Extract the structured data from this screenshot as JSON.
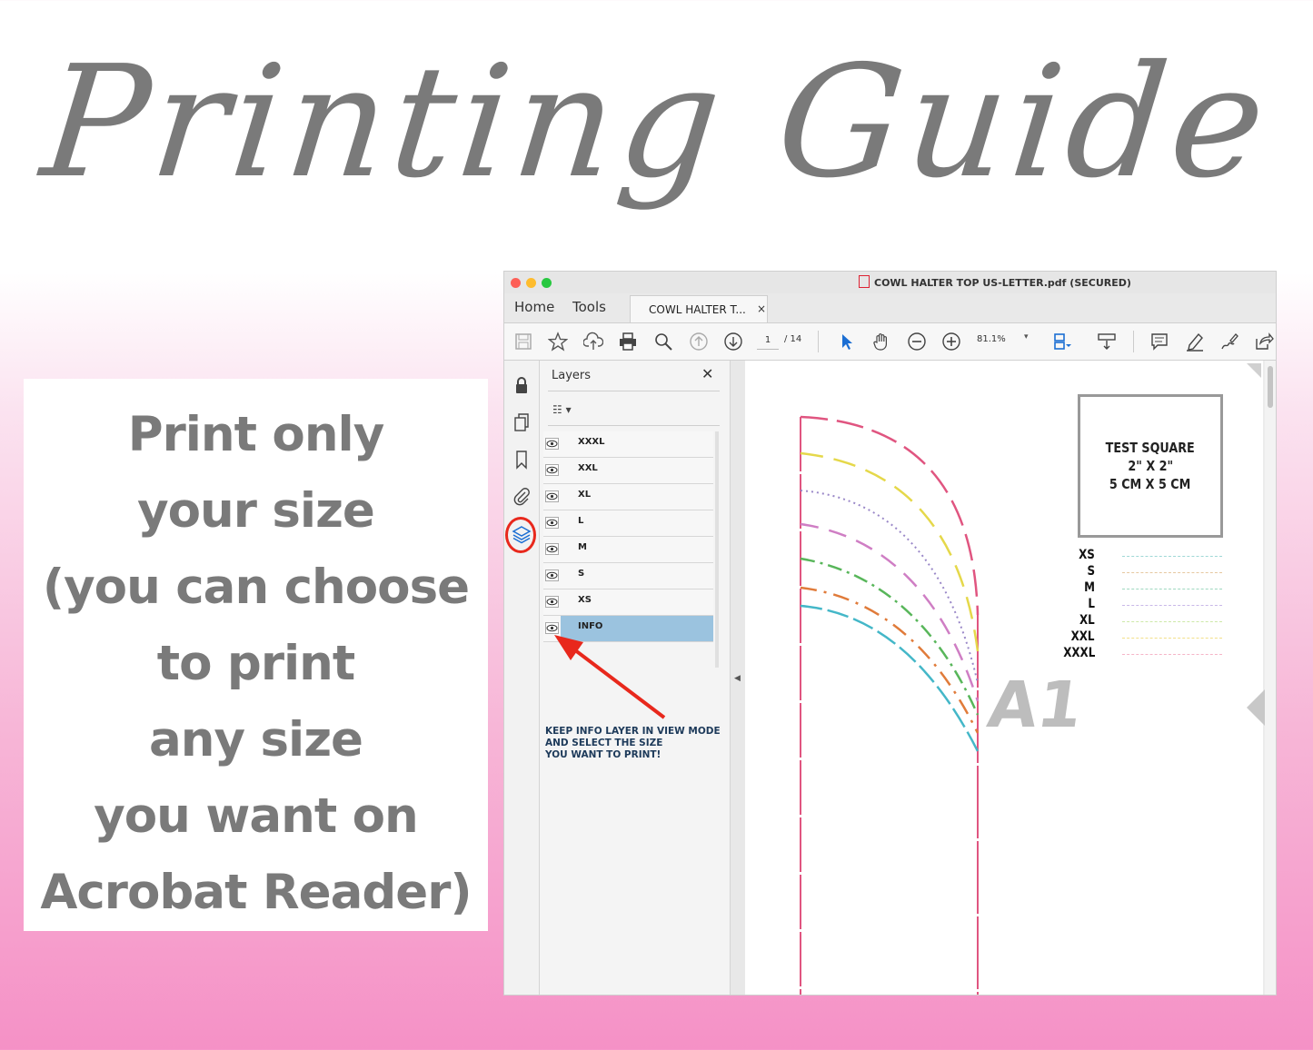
{
  "title": "Printing Guide",
  "info_card": {
    "lines": [
      "Print only",
      "your size",
      "(you can choose",
      "to print",
      "any size",
      "you want on",
      "Acrobat Reader)"
    ]
  },
  "window": {
    "title": "COWL HALTER TOP US-LETTER.pdf (SECURED)",
    "tabs": {
      "home": "Home",
      "tools": "Tools",
      "document": "COWL HALTER T...",
      "close": "×"
    },
    "toolbar": {
      "page_current": "1",
      "page_total": "/ 14",
      "zoom": "81.1%",
      "zoom_caret": "▾"
    },
    "icons": [
      "save-icon",
      "star-icon",
      "upload-icon",
      "print-icon",
      "zoom-search-icon",
      "page-up-icon",
      "page-down-icon",
      "select-arrow-icon",
      "hand-icon",
      "zoom-out-icon",
      "zoom-in-icon",
      "fit-page-icon",
      "scroll-mode-icon",
      "comment-icon",
      "highlight-icon",
      "sign-icon",
      "share-icon"
    ]
  },
  "layers_panel": {
    "title": "Layers",
    "close": "✕",
    "options_icon": "☷ ▾",
    "layers": [
      "XXXL",
      "XXL",
      "XL",
      "L",
      "M",
      "S",
      "XS",
      "INFO"
    ],
    "selected": "INFO",
    "note": "KEEP INFO LAYER IN VIEW MODE\nAND SELECT THE SIZE\nYOU WANT TO PRINT!"
  },
  "pattern_page": {
    "test_square": [
      "TEST SQUARE",
      "2\" X 2\"",
      "5 CM X 5 CM"
    ],
    "legend": [
      {
        "label": "XS",
        "color": "#9fd8d6"
      },
      {
        "label": "S",
        "color": "#e6c8a0"
      },
      {
        "label": "M",
        "color": "#9fd8c0"
      },
      {
        "label": "L",
        "color": "#c9b8e8"
      },
      {
        "label": "XL",
        "color": "#cde8a8"
      },
      {
        "label": "XXL",
        "color": "#f2e08a"
      },
      {
        "label": "XXXL",
        "color": "#f5b5c8"
      }
    ],
    "piece_label": "A1"
  },
  "colors": {
    "title_gray": "#7a7a7a",
    "highlight_ring": "#e8281c",
    "layer_selected": "#9bc3df",
    "pink_bottom": "#f591c6"
  }
}
